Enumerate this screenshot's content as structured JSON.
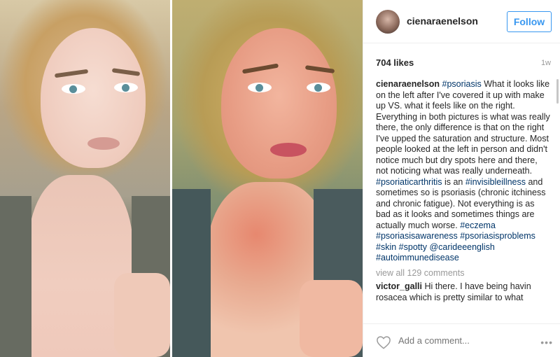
{
  "post": {
    "username": "cienaraenelson",
    "follow_label": "Follow",
    "likes": "704 likes",
    "timestamp": "1w",
    "caption": {
      "author": "cienaraenelson",
      "hashtag_first": "#psoriasis",
      "text_1": " What it looks like on the left after I've covered it up with make up VS. what it feels like on the right. Everything in both pictures is what was really there, the only difference is that on the right I've upped the saturation and structure. Most people looked at the left in person and didn't notice much but dry spots here and there, not noticing what was really underneath. ",
      "hashtag_2": "#psoriaticarthritis",
      "text_2": " is an ",
      "hashtag_3": "#invisibleillness",
      "text_3": " and sometimes so is psoriasis (chronic itchiness and chronic fatigue). Not everything is as bad as it looks and sometimes things are actually much worse. ",
      "hashtag_4": "#eczema",
      "hashtag_5": "#psoriasisawareness",
      "hashtag_6": "#psoriasisproblems",
      "hashtag_7": "#skin",
      "hashtag_8": "#spotty",
      "mention": "@carideeenglish",
      "hashtag_9": "#autoimmunedisease"
    },
    "view_all": "view all 129 comments",
    "comment": {
      "author": "victor_galli",
      "text": " Hi there. I have being havin rosacea which is pretty similar to what"
    },
    "add_comment_placeholder": "Add a comment...",
    "more_label": "•••"
  },
  "icons": {
    "heart": "heart-icon",
    "more": "more-options-icon"
  },
  "colors": {
    "accent": "#3897f0",
    "hashtag": "#003569",
    "muted": "#999999"
  }
}
